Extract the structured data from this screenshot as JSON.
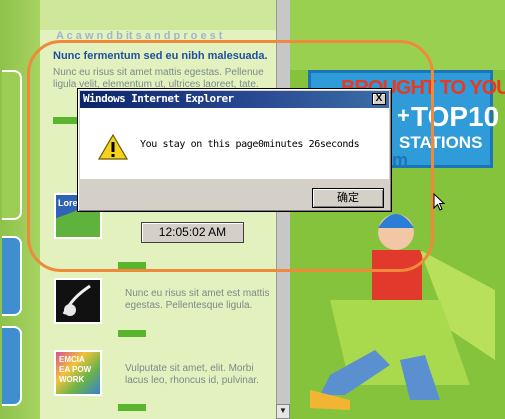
{
  "webpage": {
    "headline_faint": "A  c  a  w  n  d  b  it  s  a  n  d  p  r  o  e  s  t",
    "headline": "Nunc fermentum sed eu nibh malesuada.",
    "body_text": "Nunc eu risus sit amet mattis egestas. Pellenue ligula velit, elementum ut, ultrices laoreet, tate.",
    "clock": "12:05:02 AM",
    "thumb_lorem": "Lorem",
    "item2_text": "Nunc eu risus sit amet est mattis egestas. Pellentesque ligula.",
    "item3_text": "Vulputate sit amet, elit. Morbi lacus leo, rhoncus id, pulvinar.",
    "thumb_work": "EMCIA EA POW WORK"
  },
  "promo": {
    "line1": "BROUGHT TO YOU!",
    "plus": "+",
    "line2": "TOP10",
    "line3": "STATIONS",
    "fm": "fm"
  },
  "dialog": {
    "title": "Windows Internet Explorer",
    "close_label": "X",
    "message": "You stay on this page0minutes 26seconds",
    "ok_label": "确定",
    "icon": "warning-icon"
  },
  "colors": {
    "highlight": "#f08a3a",
    "titlebar": "#0a246a",
    "headline": "#1f4f9e"
  }
}
